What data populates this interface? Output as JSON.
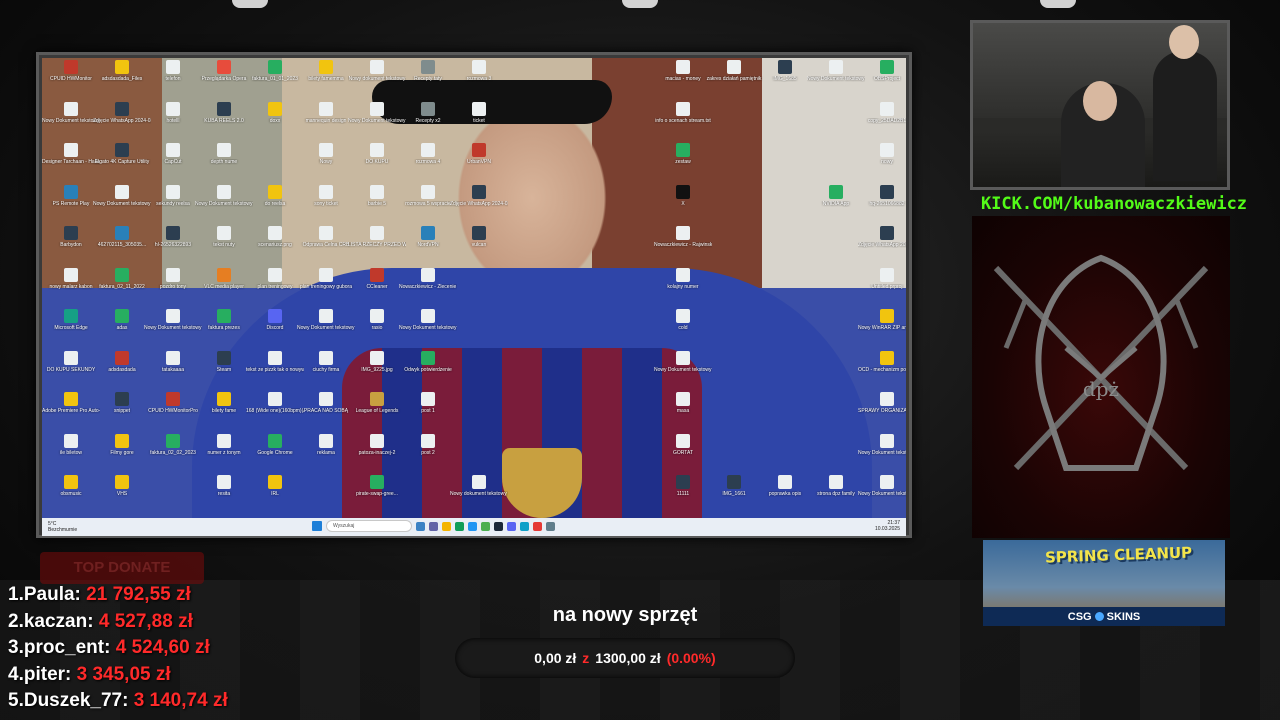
{
  "desktop": {
    "icons": [
      {
        "label": "CPUID HWMonitor",
        "color": "#c0392b",
        "col": 0,
        "row": 0
      },
      {
        "label": "adsdasdada_Files",
        "color": "#f1c40f",
        "col": 1,
        "row": 0
      },
      {
        "label": "telefon",
        "color": "#ecf0f1",
        "col": 2,
        "row": 0
      },
      {
        "label": "Przeglądarka Opera",
        "color": "#e74c3c",
        "col": 3,
        "row": 0
      },
      {
        "label": "faktura_01_01_2023",
        "color": "#27ae60",
        "col": 4,
        "row": 0
      },
      {
        "label": "bilety famemma",
        "color": "#f1c40f",
        "col": 5,
        "row": 0
      },
      {
        "label": "Nowy dokument tekstowy",
        "color": "#ecf0f1",
        "col": 6,
        "row": 0
      },
      {
        "label": "Recepty taty",
        "color": "#7f8c8d",
        "col": 7,
        "row": 0
      },
      {
        "label": "rozmowa 3",
        "color": "#ecf0f1",
        "col": 8,
        "row": 0
      },
      {
        "label": "macias - money",
        "color": "#ecf0f1",
        "col": 12,
        "row": 0
      },
      {
        "label": "zakres działań pamiętnik",
        "color": "#ecf0f1",
        "col": 13,
        "row": 0
      },
      {
        "label": "IMG_1685",
        "color": "#2c3e50",
        "col": 14,
        "row": 0
      },
      {
        "label": "Nowy Dokument tekstowy (2)",
        "color": "#ecf0f1",
        "col": 15,
        "row": 0
      },
      {
        "label": "OBSProject",
        "color": "#27ae60",
        "col": 16,
        "row": 0
      },
      {
        "label": "Nowy Dokument tekstowy (2)",
        "color": "#ecf0f1",
        "col": 0,
        "row": 1
      },
      {
        "label": "Zdjęcie WhatsApp 2024-03-18 o 18.5...",
        "color": "#2c3e50",
        "col": 1,
        "row": 1
      },
      {
        "label": "hotelll",
        "color": "#ecf0f1",
        "col": 2,
        "row": 1
      },
      {
        "label": "KUBA REELS 2.0",
        "color": "#2c3e50",
        "col": 3,
        "row": 1
      },
      {
        "label": "doxx",
        "color": "#f1c40f",
        "col": 4,
        "row": 1
      },
      {
        "label": "mannequin design",
        "color": "#ecf0f1",
        "col": 5,
        "row": 1
      },
      {
        "label": "Nowy Dokument tekstowy (23)",
        "color": "#ecf0f1",
        "col": 6,
        "row": 1
      },
      {
        "label": "Recepty x2",
        "color": "#7f8c8d",
        "col": 7,
        "row": 1
      },
      {
        "label": "ticket",
        "color": "#ecf0f1",
        "col": 8,
        "row": 1
      },
      {
        "label": "info o scenach stream.txt",
        "color": "#ecf0f1",
        "col": 12,
        "row": 1
      },
      {
        "label": "copy_25DAD2B1",
        "color": "#ecf0f1",
        "col": 16,
        "row": 1
      },
      {
        "label": "Designer Tarchaan - Hallaan",
        "color": "#ecf0f1",
        "col": 0,
        "row": 2
      },
      {
        "label": "Elgato 4K Capture Utility",
        "color": "#2c3e50",
        "col": 1,
        "row": 2
      },
      {
        "label": "CapCut",
        "color": "#ecf0f1",
        "col": 2,
        "row": 2
      },
      {
        "label": "depth nume",
        "color": "#ecf0f1",
        "col": 3,
        "row": 2
      },
      {
        "label": "Nowy",
        "color": "#ecf0f1",
        "col": 5,
        "row": 2
      },
      {
        "label": "DO KUPU",
        "color": "#ecf0f1",
        "col": 6,
        "row": 2
      },
      {
        "label": "rozmowa 4",
        "color": "#ecf0f1",
        "col": 7,
        "row": 2
      },
      {
        "label": "UrbanVPN",
        "color": "#c0392b",
        "col": 8,
        "row": 2
      },
      {
        "label": "zestaw",
        "color": "#27ae60",
        "col": 12,
        "row": 2
      },
      {
        "label": "nowy",
        "color": "#ecf0f1",
        "col": 16,
        "row": 2
      },
      {
        "label": "PS Remote Play",
        "color": "#2980b9",
        "col": 0,
        "row": 3
      },
      {
        "label": "Nowy Dokument tekstowy (5)",
        "color": "#ecf0f1",
        "col": 1,
        "row": 3
      },
      {
        "label": "sekundy reelsa",
        "color": "#ecf0f1",
        "col": 2,
        "row": 3
      },
      {
        "label": "Nowy Dokument tekstowy (3)",
        "color": "#ecf0f1",
        "col": 3,
        "row": 3
      },
      {
        "label": "do reelsa",
        "color": "#f1c40f",
        "col": 4,
        "row": 3
      },
      {
        "label": "sony ticket",
        "color": "#ecf0f1",
        "col": 5,
        "row": 3
      },
      {
        "label": "barbie 5",
        "color": "#ecf0f1",
        "col": 6,
        "row": 3
      },
      {
        "label": "rozmowa 5 wspracie",
        "color": "#ecf0f1",
        "col": 7,
        "row": 3
      },
      {
        "label": "Zdjęcie WhatsApp 2024-03-18 o 11...",
        "color": "#2c3e50",
        "col": 8,
        "row": 3
      },
      {
        "label": "X",
        "color": "#111111",
        "col": 12,
        "row": 3
      },
      {
        "label": "NVIDIA App",
        "color": "#27ae60",
        "col": 15,
        "row": 3
      },
      {
        "label": "hq-2651066882",
        "color": "#2c3e50",
        "col": 16,
        "row": 3
      },
      {
        "label": "Barbydon",
        "color": "#2c3e50",
        "col": 0,
        "row": 4
      },
      {
        "label": "462702115_305035...",
        "color": "#2980b9",
        "col": 1,
        "row": 4
      },
      {
        "label": "hl-26526322893",
        "color": "#2c3e50",
        "col": 2,
        "row": 4
      },
      {
        "label": "tekst nuty",
        "color": "#ecf0f1",
        "col": 3,
        "row": 4
      },
      {
        "label": "scenariusz.png",
        "color": "#ecf0f1",
        "col": 4,
        "row": 4
      },
      {
        "label": "Odprawa Celna CRB",
        "color": "#ecf0f1",
        "col": 5,
        "row": 4
      },
      {
        "label": "LISTA RZECZY PRZED WYJAZDEM",
        "color": "#ecf0f1",
        "col": 6,
        "row": 4
      },
      {
        "label": "NordVPN",
        "color": "#2980b9",
        "col": 7,
        "row": 4
      },
      {
        "label": "vulcan",
        "color": "#2c3e50",
        "col": 8,
        "row": 4
      },
      {
        "label": "Nowaczkiewicz - Rajwinski MSC",
        "color": "#ecf0f1",
        "col": 12,
        "row": 4
      },
      {
        "label": "Zdjęcie WhatsApp 2024-11-04 o 14...",
        "color": "#2c3e50",
        "col": 16,
        "row": 4
      },
      {
        "label": "nowy malarz kabon",
        "color": "#ecf0f1",
        "col": 0,
        "row": 5
      },
      {
        "label": "faktura_02_11_2022",
        "color": "#27ae60",
        "col": 1,
        "row": 5
      },
      {
        "label": "pozdro tony",
        "color": "#ecf0f1",
        "col": 2,
        "row": 5
      },
      {
        "label": "VLC media player",
        "color": "#e67e22",
        "col": 3,
        "row": 5
      },
      {
        "label": "plan treningowy",
        "color": "#ecf0f1",
        "col": 4,
        "row": 5
      },
      {
        "label": "plan treningowy gubora",
        "color": "#ecf0f1",
        "col": 5,
        "row": 5
      },
      {
        "label": "CCleaner",
        "color": "#c0392b",
        "col": 6,
        "row": 5
      },
      {
        "label": "Nowaczkiewicz - Zlecenie Bankowe...",
        "color": "#ecf0f1",
        "col": 7,
        "row": 5
      },
      {
        "label": "kolajny numer",
        "color": "#ecf0f1",
        "col": 12,
        "row": 5
      },
      {
        "label": "Untitled.prproj",
        "color": "#ecf0f1",
        "col": 16,
        "row": 5
      },
      {
        "label": "Microsoft Edge",
        "color": "#16a085",
        "col": 0,
        "row": 6
      },
      {
        "label": "adas",
        "color": "#27ae60",
        "col": 1,
        "row": 6
      },
      {
        "label": "Nowy Dokument tekstowy (11)",
        "color": "#ecf0f1",
        "col": 2,
        "row": 6
      },
      {
        "label": "faktura prezes",
        "color": "#27ae60",
        "col": 3,
        "row": 6
      },
      {
        "label": "Discord",
        "color": "#5865f2",
        "col": 4,
        "row": 6
      },
      {
        "label": "Nowy Dokument tekstowy (6)",
        "color": "#ecf0f1",
        "col": 5,
        "row": 6
      },
      {
        "label": "rasio",
        "color": "#ecf0f1",
        "col": 6,
        "row": 6
      },
      {
        "label": "Nowy Dokument tekstowy (14)",
        "color": "#ecf0f1",
        "col": 7,
        "row": 6
      },
      {
        "label": "cold",
        "color": "#ecf0f1",
        "col": 12,
        "row": 6
      },
      {
        "label": "Nowy WinRAR ZIP archive",
        "color": "#f1c40f",
        "col": 16,
        "row": 6
      },
      {
        "label": "DO KUPU SEKUNDY",
        "color": "#ecf0f1",
        "col": 0,
        "row": 7
      },
      {
        "label": "adsdasdada",
        "color": "#c0392b",
        "col": 1,
        "row": 7
      },
      {
        "label": "tatakaaaa",
        "color": "#ecf0f1",
        "col": 2,
        "row": 7
      },
      {
        "label": "Steam",
        "color": "#2c3e50",
        "col": 3,
        "row": 7
      },
      {
        "label": "tekst ze pizzk tak o nowyw",
        "color": "#ecf0f1",
        "col": 4,
        "row": 7
      },
      {
        "label": "ciuchy firma",
        "color": "#ecf0f1",
        "col": 5,
        "row": 7
      },
      {
        "label": "IMG_9225.jpg",
        "color": "#ecf0f1",
        "col": 6,
        "row": 7
      },
      {
        "label": "Odwyk potwierdzenie",
        "color": "#27ae60",
        "col": 7,
        "row": 7
      },
      {
        "label": "Nowy Dokument tekstowy (8)",
        "color": "#ecf0f1",
        "col": 12,
        "row": 7
      },
      {
        "label": "OCD - mechanizm podrzymujący",
        "color": "#f1c40f",
        "col": 16,
        "row": 7
      },
      {
        "label": "Adobe Premiere Pro Auto-Save",
        "color": "#f1c40f",
        "col": 0,
        "row": 8
      },
      {
        "label": "snippet",
        "color": "#2c3e50",
        "col": 1,
        "row": 8
      },
      {
        "label": "CPUID HWMonitorPro",
        "color": "#c0392b",
        "col": 2,
        "row": 8
      },
      {
        "label": "bilety fame",
        "color": "#f1c40f",
        "col": 3,
        "row": 8
      },
      {
        "label": "168 (Wide one)(160bpm)(A.b...",
        "color": "#ecf0f1",
        "col": 4,
        "row": 8
      },
      {
        "label": "PRACA NAD SOBĄ",
        "color": "#ecf0f1",
        "col": 5,
        "row": 8
      },
      {
        "label": "League of Legends",
        "color": "#c8a040",
        "col": 6,
        "row": 8
      },
      {
        "label": "post 1",
        "color": "#ecf0f1",
        "col": 7,
        "row": 8
      },
      {
        "label": "masa",
        "color": "#ecf0f1",
        "col": 12,
        "row": 8
      },
      {
        "label": "SPRAWY ORGANIZACYJ...",
        "color": "#ecf0f1",
        "col": 16,
        "row": 8
      },
      {
        "label": "ile biletow",
        "color": "#ecf0f1",
        "col": 0,
        "row": 9
      },
      {
        "label": "Filmy gore",
        "color": "#f1c40f",
        "col": 1,
        "row": 9
      },
      {
        "label": "faktura_02_02_2023",
        "color": "#27ae60",
        "col": 2,
        "row": 9
      },
      {
        "label": "numer z tonym",
        "color": "#ecf0f1",
        "col": 3,
        "row": 9
      },
      {
        "label": "Google Chrome",
        "color": "#27ae60",
        "col": 4,
        "row": 9
      },
      {
        "label": "reklama",
        "color": "#ecf0f1",
        "col": 5,
        "row": 9
      },
      {
        "label": "patoza-inaczej-2",
        "color": "#ecf0f1",
        "col": 6,
        "row": 9
      },
      {
        "label": "post 2",
        "color": "#ecf0f1",
        "col": 7,
        "row": 9
      },
      {
        "label": "GORTAT",
        "color": "#ecf0f1",
        "col": 12,
        "row": 9
      },
      {
        "label": "Nowy Dokument tekstowy (3)",
        "color": "#ecf0f1",
        "col": 16,
        "row": 9
      },
      {
        "label": "obsmusic",
        "color": "#f1c40f",
        "col": 0,
        "row": 10
      },
      {
        "label": "VHS",
        "color": "#f1c40f",
        "col": 1,
        "row": 10
      },
      {
        "label": "resita",
        "color": "#ecf0f1",
        "col": 3,
        "row": 10
      },
      {
        "label": "IRL",
        "color": "#f1c40f",
        "col": 4,
        "row": 10
      },
      {
        "label": "pirate-swap-gree...",
        "color": "#27ae60",
        "col": 6,
        "row": 10
      },
      {
        "label": "Nowy dokument tekstowy (4)",
        "color": "#ecf0f1",
        "col": 8,
        "row": 10
      },
      {
        "label": "11111",
        "color": "#2c3e50",
        "col": 12,
        "row": 10
      },
      {
        "label": "IMG_1661",
        "color": "#2c3e50",
        "col": 13,
        "row": 10
      },
      {
        "label": "poprawka opis",
        "color": "#ecf0f1",
        "col": 14,
        "row": 10
      },
      {
        "label": "strona dpz family",
        "color": "#ecf0f1",
        "col": 15,
        "row": 10
      },
      {
        "label": "Nowy Dokument tekstowy (9)",
        "color": "#ecf0f1",
        "col": 16,
        "row": 10
      }
    ]
  },
  "taskbar": {
    "weather_temp": "5°C",
    "weather_desc": "Bezchmurnie",
    "search_placeholder": "Wyszukaj",
    "time": "21:37",
    "date": "10.03.2025",
    "apps": [
      "#3b82c4",
      "#6264a7",
      "#f4b400",
      "#0f9d58",
      "#2196f3",
      "#4caf50",
      "#1b2838",
      "#5865f2",
      "#0fa0c8",
      "#e53935",
      "#607d8b"
    ]
  },
  "overlay": {
    "kick_url": "KICK.COM/kubanowaczkiewicz",
    "logo_text": "dpż",
    "sponsor": {
      "title": "SPRING CLEANUP",
      "brand_left": "CSG",
      "brand_right": "SKINS"
    },
    "top_donate_label": "TOP DONATE",
    "donors": [
      {
        "rank": "1.",
        "name": "Paula:",
        "amount": "21 792,55 zł"
      },
      {
        "rank": "2.",
        "name": "kaczan:",
        "amount": "4 527,88 zł"
      },
      {
        "rank": "3.",
        "name": "proc_ent:",
        "amount": "4 524,60 zł"
      },
      {
        "rank": "4.",
        "name": "piter:",
        "amount": "3 345,05 zł"
      },
      {
        "rank": "5.",
        "name": "Duszek_77:",
        "amount": "3 140,74 zł"
      }
    ],
    "goal": {
      "title": "na nowy sprzęt",
      "current": "0,00 zł",
      "separator": "z",
      "target": "1300,00 zł",
      "percent_label": "(0.00%)",
      "progress": 0
    }
  }
}
